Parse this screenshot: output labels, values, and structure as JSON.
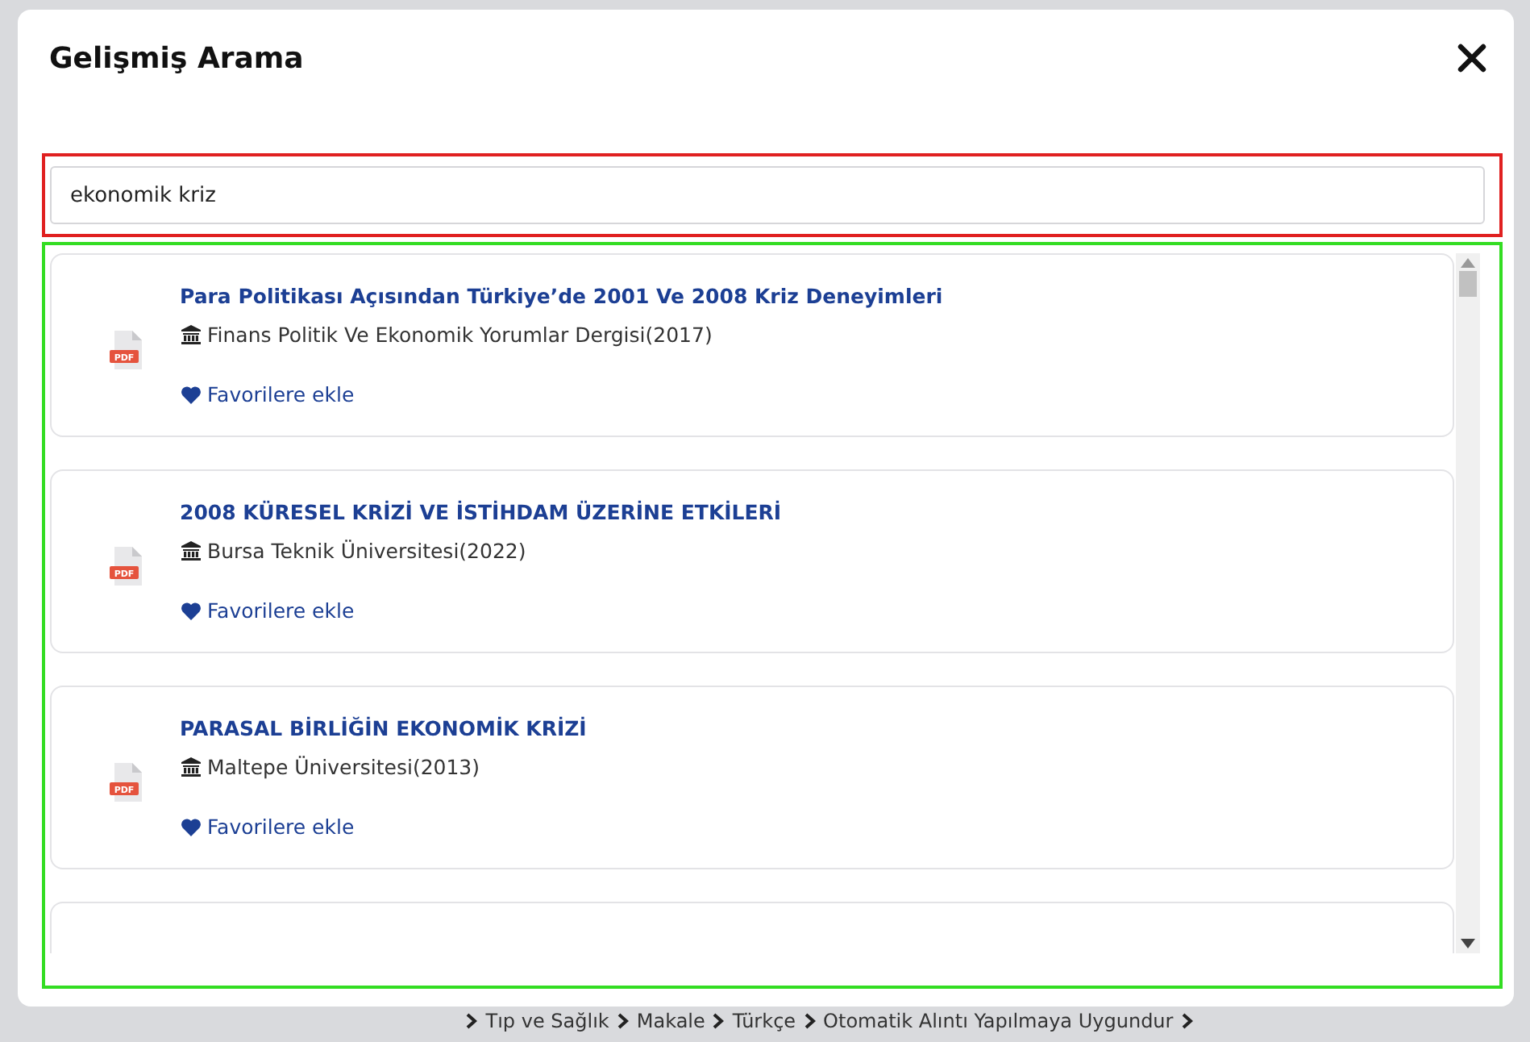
{
  "dialog": {
    "title": "Gelişmiş Arama"
  },
  "search": {
    "value": "ekonomik kriz"
  },
  "results": [
    {
      "kind": "full",
      "file_type": "PDF",
      "title": "Para Politikası Açısından Türkiye’de 2001 Ve 2008 Kriz Deneyimleri",
      "source": "Finans Politik Ve Ekonomik Yorumlar Dergisi(2017)",
      "favorite": "Favorilere ekle"
    },
    {
      "kind": "full",
      "file_type": "PDF",
      "title": "2008 KÜRESEL KRİZİ VE İSTİHDAM ÜZERİNE ETKİLERİ",
      "source": "Bursa Teknik Üniversitesi(2022)",
      "favorite": "Favorilere ekle"
    },
    {
      "kind": "full",
      "file_type": "PDF",
      "title": "PARASAL BİRLİĞİN EKONOMİK KRİZİ",
      "source": "Maltepe Üniversitesi(2013)",
      "favorite": "Favorilere ekle"
    },
    {
      "kind": "partial"
    }
  ],
  "breadcrumb": [
    "Tıp ve Sağlık",
    "Makale",
    "Türkçe",
    "Otomatik Alıntı Yapılmaya Uygundur"
  ]
}
